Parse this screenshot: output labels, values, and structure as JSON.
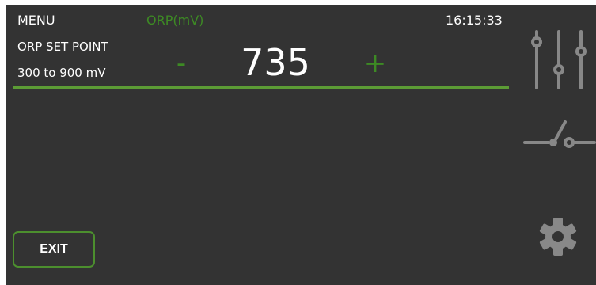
{
  "header": {
    "menu_label": "MENU",
    "mode_label": "ORP(mV)",
    "time": "16:15:33"
  },
  "setpoint": {
    "title": "ORP SET POINT",
    "range": "300 to 900 mV",
    "value": "735",
    "decrement_symbol": "-",
    "increment_symbol": "+"
  },
  "footer": {
    "exit_label": "EXIT"
  },
  "side_icons": [
    "sliders-icon",
    "switch-icon",
    "gear-icon"
  ],
  "colors": {
    "background": "#333333",
    "accent_green": "#3d8a24",
    "icon_gray": "#888888",
    "text": "#ffffff"
  }
}
